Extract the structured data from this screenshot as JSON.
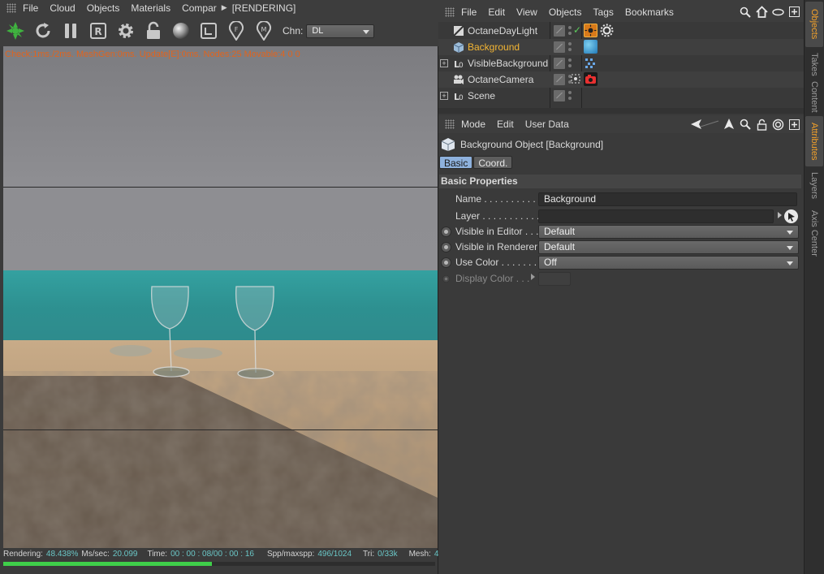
{
  "viewer": {
    "menu": [
      "File",
      "Cloud",
      "Objects",
      "Materials",
      "Compar"
    ],
    "rendering_tag": "[RENDERING]",
    "toolbar_icons": [
      "octane-logo-icon",
      "refresh-icon",
      "pause-icon",
      "region-render-icon",
      "settings-gear-icon",
      "lock-icon",
      "material-ball-icon",
      "crop-icon",
      "focus-pick-icon",
      "material-pick-icon"
    ],
    "channel_label": "Chn:",
    "channel_value": "DL",
    "stats_line": "Check:1ms./2ms. MeshGen:0ms. Update[E]:0ms. Nodes:25 Movable:4  0 0",
    "status": {
      "rendering_label": "Rendering:",
      "rendering_value": "48.438%",
      "mssec_label": "Ms/sec:",
      "mssec_value": "20.099",
      "time_label": "Time:",
      "time_value": "00 : 00 : 08/00 : 00 : 16",
      "spp_label": "Spp/maxspp:",
      "spp_value": "496/1024",
      "tri_label": "Tri:",
      "tri_value": "0/33k",
      "mesh_label": "Mesh:",
      "mesh_value": "4"
    },
    "progress": 0.484
  },
  "object_manager": {
    "menu": [
      "File",
      "Edit",
      "View",
      "Objects",
      "Tags",
      "Bookmarks"
    ],
    "icons": [
      "search-icon",
      "home-icon",
      "eye-toggle-icon",
      "new-panel-icon"
    ],
    "objects": [
      {
        "name": "OctaneDayLight",
        "icon": "daylight-object-icon",
        "expandable": false,
        "selected": false
      },
      {
        "name": "Background",
        "icon": "background-object-icon",
        "expandable": false,
        "selected": true
      },
      {
        "name": "VisibleBackground",
        "icon": "null-object-icon",
        "expandable": true,
        "selected": false
      },
      {
        "name": "OctaneCamera",
        "icon": "camera-object-icon",
        "expandable": false,
        "selected": false
      },
      {
        "name": "Scene",
        "icon": "null-object-icon",
        "expandable": true,
        "selected": false
      }
    ]
  },
  "attribute_manager": {
    "menu": [
      "Mode",
      "Edit",
      "User Data"
    ],
    "icons": [
      "back-arrow-icon",
      "cursor-icon",
      "search-icon",
      "lock-icon",
      "target-icon",
      "new-panel-icon"
    ],
    "title": "Background Object [Background]",
    "tabs": [
      "Basic",
      "Coord."
    ],
    "active_tab": "Basic",
    "section": "Basic Properties",
    "props": {
      "name_label": "Name . . . . . . . . . . .",
      "name_value": "Background",
      "layer_label": "Layer . . . . . . . . . . .",
      "layer_value": "",
      "vis_editor_label": "Visible in Editor . . .",
      "vis_editor_value": "Default",
      "vis_renderer_label": "Visible in Renderer",
      "vis_renderer_value": "Default",
      "use_color_label": "Use Color  . . . . . . .",
      "use_color_value": "Off",
      "display_color_label": "Display Color . . ."
    }
  },
  "side_tabs": [
    {
      "label": "Objects",
      "active": true
    },
    {
      "label": "Takes",
      "active": false
    },
    {
      "label": "Content",
      "active": false
    },
    {
      "label": "Attributes",
      "active": true
    },
    {
      "label": "Layers",
      "active": false
    },
    {
      "label": "Axis Center",
      "active": false
    }
  ],
  "colors": {
    "accent_orange": "#f3a12a",
    "selected_object": "#f3b533",
    "stats_text": "#e0641e",
    "status_value": "#6ac6c6",
    "progress": "#3fcf4a",
    "tab_active": "#8eb1dd"
  }
}
